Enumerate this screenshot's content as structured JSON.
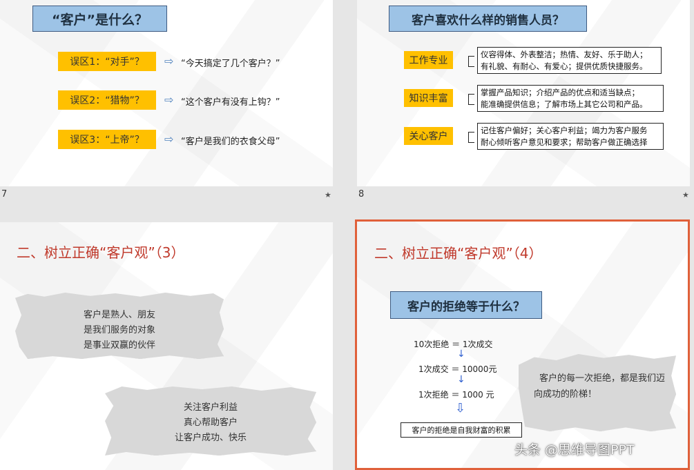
{
  "slide7": {
    "number": "7",
    "title": "“客户”是什么？",
    "items": [
      {
        "label": "误区1：“对手”？",
        "text": "“今天搞定了几个客户？”"
      },
      {
        "label": "误区2：“猎物”？",
        "text": "“这个客户有没有上钩？”"
      },
      {
        "label": "误区3：“上帝”？",
        "text": "“客户是我们的衣食父母”"
      }
    ],
    "star": "★"
  },
  "slide8": {
    "number": "8",
    "title": "客户喜欢什么样的销售人员？",
    "items": [
      {
        "label": "工作专业",
        "line1": "仪容得体、外表整洁；热情、友好、乐于助人；",
        "line2": "有礼貌、有耐心、有爱心；提供优质快捷服务。"
      },
      {
        "label": "知识丰富",
        "line1": "掌握产品知识；介绍产品的优点和适当缺点；",
        "line2": "能准确提供信息；了解市场上其它公司和产品。"
      },
      {
        "label": "关心客户",
        "line1": "记住客户偏好；关心客户利益；竭力为客户服务",
        "line2": "耐心倾听客户意见和要求；帮助客户做正确选择"
      }
    ],
    "star": "★"
  },
  "slide9": {
    "title": "二、树立正确“客户观”（3）",
    "paper1": [
      "客户是熟人、朋友",
      "是我们服务的对象",
      "是事业双赢的伙伴"
    ],
    "paper2": [
      "关注客户利益",
      "真心帮助客户",
      "让客户成功、快乐"
    ]
  },
  "slide10": {
    "title": "二、树立正确“客户观”（4）",
    "box_title": "客户的拒绝等于什么？",
    "eq1": "10次拒绝  ＝  1次成交",
    "eq2": "1次成交  ＝  10000元",
    "eq3": "1次拒绝  ＝  1000  元",
    "conclusion": "客户的拒绝是自我财富的积累",
    "paper": [
      "客户的每一次拒绝，都是我们迈",
      "向成功的阶梯！"
    ]
  },
  "watermark": "头条 @思维导图PPT"
}
